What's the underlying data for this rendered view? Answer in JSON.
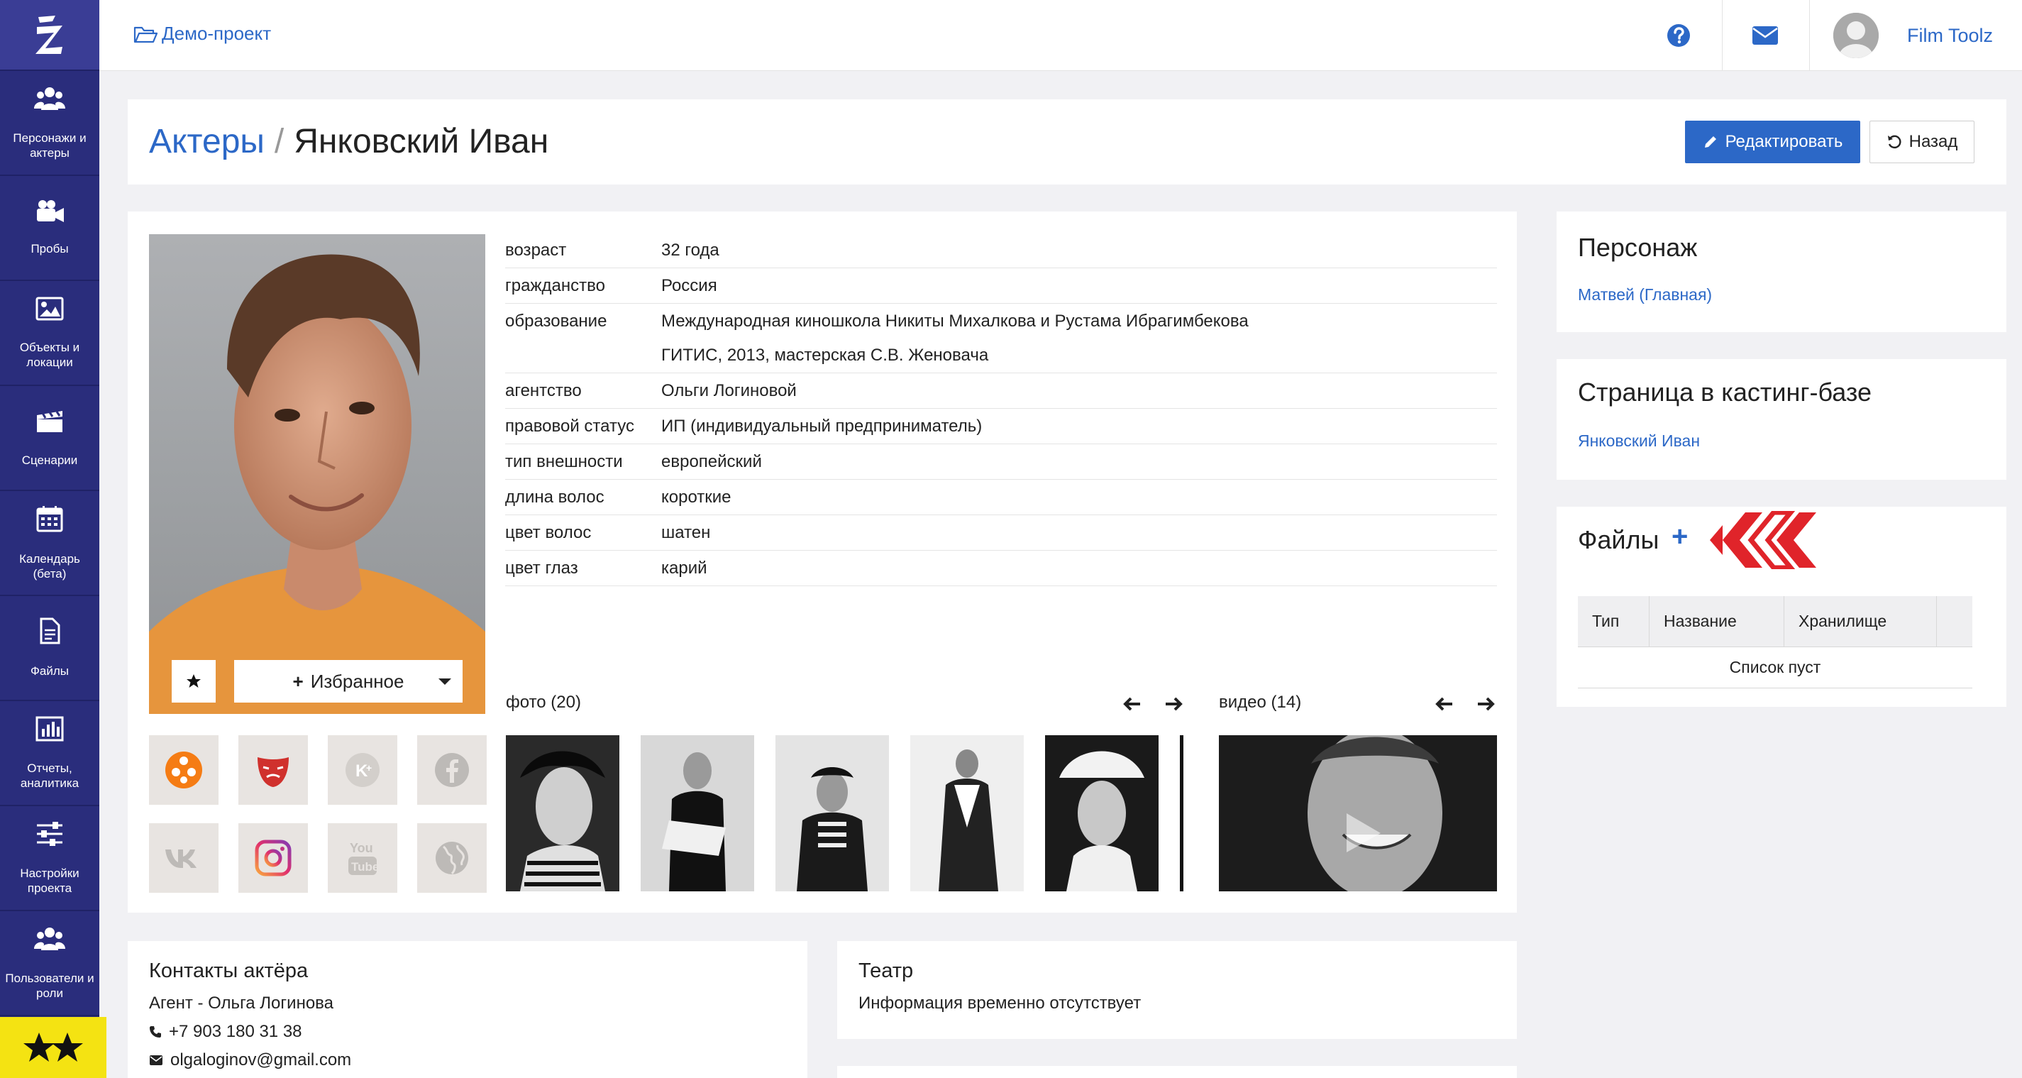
{
  "topbar": {
    "project": "Демо-проект",
    "user_name": "Film Toolz"
  },
  "sidebar": {
    "items": [
      {
        "label": "Персонажи и актеры",
        "icon": "users-icon"
      },
      {
        "label": "Пробы",
        "icon": "video-camera-icon"
      },
      {
        "label": "Объекты и локации",
        "icon": "image-icon"
      },
      {
        "label": "Сценарии",
        "icon": "clapperboard-icon"
      },
      {
        "label": "Календарь (бета)",
        "icon": "calendar-icon"
      },
      {
        "label": "Файлы",
        "icon": "file-icon"
      },
      {
        "label": "Отчеты, аналитика",
        "icon": "bar-chart-icon"
      },
      {
        "label": "Настройки проекта",
        "icon": "sliders-icon"
      },
      {
        "label": "Пользователи и роли",
        "icon": "users-icon"
      }
    ]
  },
  "header": {
    "breadcrumb_link": "Актеры",
    "separator": "/",
    "title": "Янковский Иван",
    "edit_label": "Редактировать",
    "back_label": "Назад"
  },
  "profile": {
    "favorite_label": "Избранное",
    "info": [
      {
        "key": "возраст",
        "values": [
          "32 года"
        ]
      },
      {
        "key": "гражданство",
        "values": [
          "Россия"
        ]
      },
      {
        "key": "образование",
        "values": [
          "Международная киношкола Никиты Михалкова и Рустама Ибрагимбекова",
          "ГИТИС, 2013, мастерская С.В. Женовача"
        ]
      },
      {
        "key": "агентство",
        "values": [
          "Ольги Логиновой"
        ]
      },
      {
        "key": "правовой статус",
        "values": [
          "ИП (индивидуальный предприниматель)"
        ]
      },
      {
        "key": "тип внешности",
        "values": [
          "европейский"
        ]
      },
      {
        "key": "длина волос",
        "values": [
          "короткие"
        ]
      },
      {
        "key": "цвет волос",
        "values": [
          "шатен"
        ]
      },
      {
        "key": "цвет глаз",
        "values": [
          "карий"
        ]
      }
    ],
    "photos_label": "фото (20)",
    "video_label": "видео (14)",
    "socials": [
      "kinopoisk-icon",
      "theatre-mask-icon",
      "kinoteatr-icon",
      "facebook-icon",
      "vk-icon",
      "instagram-icon",
      "youtube-icon",
      "globe-icon"
    ]
  },
  "right": {
    "character_title": "Персонаж",
    "character_link": "Матвей (Главная)",
    "casting_title": "Страница в кастинг-базе",
    "casting_link": "Янковский Иван",
    "files_title": "Файлы",
    "files_add": "+",
    "files_columns": [
      "Тип",
      "Название",
      "Хранилище"
    ],
    "files_empty": "Список пуст"
  },
  "contacts": {
    "title": "Контакты актёра",
    "agent": "Агент - Ольга Логинова",
    "phone": "+7 903 180 31 38",
    "email": "olgaloginov@gmail.com"
  },
  "theatre": {
    "title": "Театр",
    "text": "Информация временно отсутствует"
  },
  "colors": {
    "sidebar": "#2a2d7c",
    "accent": "#2c68c7",
    "badge": "#f4e312"
  }
}
